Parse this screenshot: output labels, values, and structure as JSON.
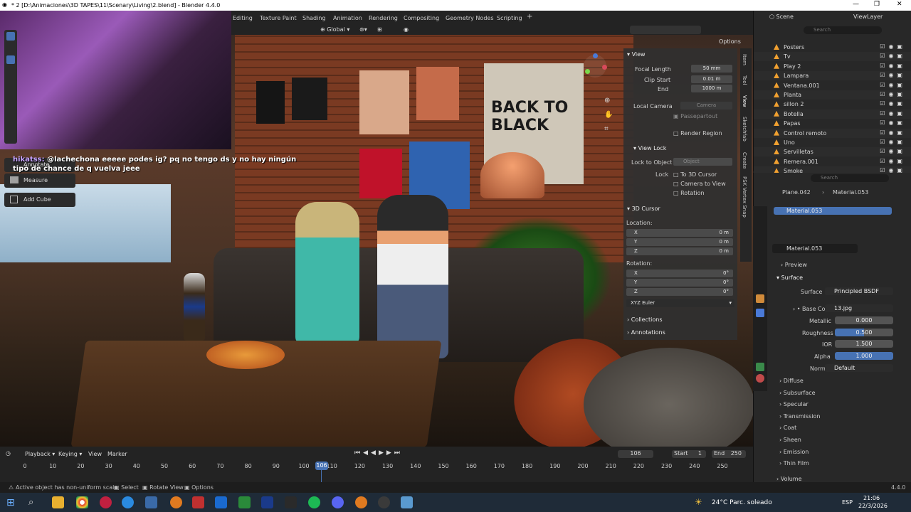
{
  "window": {
    "title": "* 2 [D:\\Animaciones\\3D TAPES\\11\\Scenary\\Living\\2.blend] - Blender 4.4.0"
  },
  "workspaces": [
    "Editing",
    "Texture Paint",
    "Shading",
    "Animation",
    "Rendering",
    "Compositing",
    "Geometry Nodes",
    "Scripting"
  ],
  "viewport_header": {
    "orientation": "Global",
    "options": "Options"
  },
  "chat": {
    "nick": "hikatss:",
    "message": " @lachechona eeeee podes ig? pq no tengo ds y no hay ningún tipo de chance de q vuelva jeee"
  },
  "tools": {
    "annotate": "Annotate",
    "measure": "Measure",
    "add_cube": "Add Cube"
  },
  "npanel": {
    "view_header": "View",
    "focal_length_label": "Focal Length",
    "focal_length": "50 mm",
    "clip_start_label": "Clip Start",
    "clip_start": "0.01 m",
    "end_label": "End",
    "end": "1000 m",
    "local_camera_label": "Local Camera",
    "camera": "Camera",
    "passepartout": "Passepartout",
    "render_region": "Render Region",
    "view_lock_header": "View Lock",
    "lock_to_object_label": "Lock to Object",
    "object_placeholder": "Object",
    "lock_label": "Lock",
    "to_3d_cursor": "To 3D Cursor",
    "camera_to_view": "Camera to View",
    "rotation": "Rotation",
    "cursor_header": "3D Cursor",
    "location_label": "Location:",
    "rotation_label": "Rotation:",
    "axes": [
      "X",
      "Y",
      "Z"
    ],
    "loc_values": [
      "0 m",
      "0 m",
      "0 m"
    ],
    "rot_values": [
      "0°",
      "0°",
      "0°"
    ],
    "rotation_mode": "XYZ Euler",
    "collections": "Collections",
    "annotations": "Annotations",
    "tabs": [
      "Item",
      "Tool",
      "View",
      "Sketchfab",
      "Create",
      "PSK Vertex Snap"
    ]
  },
  "outliner": {
    "scene": "Scene",
    "view_layer": "ViewLayer",
    "search_placeholder": "Search",
    "items": [
      "Posters",
      "Tv",
      "Play 2",
      "Lampara",
      "Ventana.001",
      "Planta",
      "sillon 2",
      "Botella",
      "Papas",
      "Control remoto",
      "Uno",
      "Servilletas",
      "Remera.001",
      "Smoke"
    ]
  },
  "properties": {
    "search_placeholder": "Search",
    "object": "Plane.042",
    "material": "Material.053",
    "slot": "Material.053",
    "preview": "Preview",
    "surface": "Surface",
    "surface_label": "Surface",
    "surface_value": "Principled BSDF",
    "base_color_label": "Base Color",
    "base_color_value": "13.jpg",
    "metallic_label": "Metallic",
    "metallic_value": "0.000",
    "roughness_label": "Roughness",
    "roughness_value": "0.500",
    "ior_label": "IOR",
    "ior_value": "1.500",
    "alpha_label": "Alpha",
    "alpha_value": "1.000",
    "normal_label": "Normal",
    "normal_value": "Default",
    "sections": [
      "Diffuse",
      "Subsurface",
      "Specular",
      "Transmission",
      "Coat",
      "Sheen",
      "Emission",
      "Thin Film"
    ],
    "volume": "Volume"
  },
  "timeline": {
    "playback": "Playback",
    "keying": "Keying",
    "view": "View",
    "marker": "Marker",
    "current_frame": "106",
    "start_label": "Start",
    "start": "1",
    "end_label": "End",
    "end": "250",
    "ticks": [
      "0",
      "10",
      "20",
      "30",
      "40",
      "50",
      "60",
      "70",
      "80",
      "90",
      "100",
      "110",
      "120",
      "130",
      "140",
      "150",
      "160",
      "170",
      "180",
      "190",
      "200",
      "210",
      "220",
      "230",
      "240",
      "250"
    ],
    "playhead_label": "106"
  },
  "status": {
    "message": "Active object has non-uniform scale",
    "select": "Select",
    "rotate_view": "Rotate View",
    "options": "Options",
    "version": "4.4.0"
  },
  "taskbar": {
    "weather": "24°C  Parc. soleado",
    "lang": "ESP",
    "time": "21:06",
    "date": "22/3/2026"
  },
  "colors": {
    "accent_blue": "#4772b3",
    "brick": "#8a3c22"
  }
}
